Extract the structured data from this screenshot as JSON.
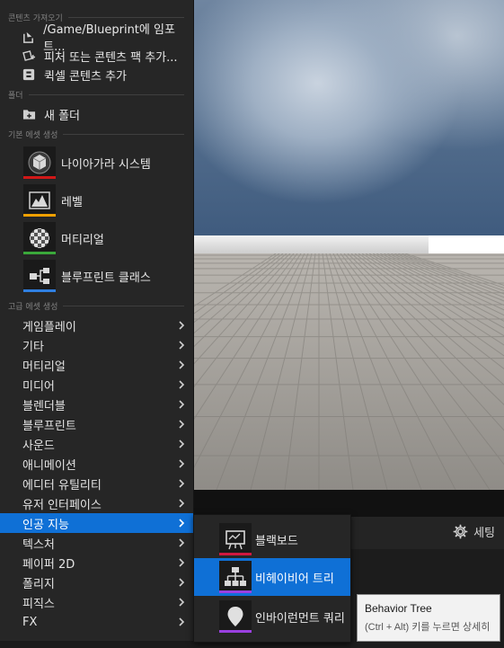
{
  "import_section": {
    "header": "콘텐츠 가져오기",
    "items": [
      {
        "label": "/Game/Blueprint에 임포트...",
        "icon": "import-icon"
      },
      {
        "label": "피처 또는 콘텐츠 팩 추가...",
        "icon": "feature-pack-icon"
      },
      {
        "label": "퀵셀 콘텐츠 추가",
        "icon": "quixel-icon"
      }
    ]
  },
  "folder_section": {
    "header": "폴더",
    "items": [
      {
        "label": "새 폴더",
        "icon": "new-folder-icon"
      }
    ]
  },
  "basic_assets": {
    "header": "기본 에셋 생성",
    "items": [
      {
        "label": "나이아가라 시스템",
        "icon": "niagara-icon",
        "color": "#d01818"
      },
      {
        "label": "레벨",
        "icon": "level-icon",
        "color": "#f0a000"
      },
      {
        "label": "머티리얼",
        "icon": "material-icon",
        "color": "#3aa83a"
      },
      {
        "label": "블루프린트 클래스",
        "icon": "blueprint-icon",
        "color": "#2f7fe0"
      }
    ]
  },
  "advanced_assets": {
    "header": "고급 에셋 생성",
    "items": [
      {
        "label": "게임플레이"
      },
      {
        "label": "기타"
      },
      {
        "label": "머티리얼"
      },
      {
        "label": "미디어"
      },
      {
        "label": "블렌더블"
      },
      {
        "label": "블루프린트"
      },
      {
        "label": "사운드"
      },
      {
        "label": "애니메이션"
      },
      {
        "label": "에디터 유틸리티"
      },
      {
        "label": "유저 인터페이스"
      },
      {
        "label": "인공 지능",
        "selected": true
      },
      {
        "label": "텍스처"
      },
      {
        "label": "페이퍼 2D"
      },
      {
        "label": "폴리지"
      },
      {
        "label": "피직스"
      },
      {
        "label": "FX"
      }
    ]
  },
  "ai_submenu": {
    "items": [
      {
        "label": "블랙보드",
        "icon": "blackboard-icon",
        "color": "#d01840"
      },
      {
        "label": "비헤이비어 트리",
        "icon": "behavior-tree-icon",
        "color": "#9a40e0",
        "selected": true
      },
      {
        "label": "인바이런먼트 쿼리",
        "icon": "environment-query-icon",
        "color": "#9a40e0"
      }
    ]
  },
  "tooltip": {
    "title": "Behavior Tree",
    "hint": "(Ctrl + Alt) 키를 누르면 상세히"
  },
  "details_panel": {
    "settings_label": "세팅",
    "settings_icon": "gear-icon"
  },
  "colors": {
    "selection": "#0f70d6",
    "menu_bg": "#262626"
  }
}
